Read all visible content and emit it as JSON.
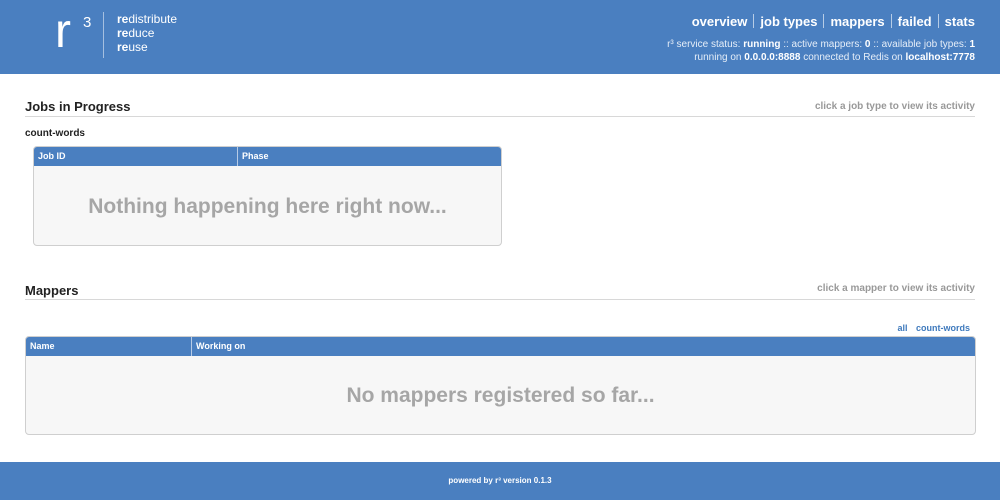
{
  "header": {
    "logo": {
      "r": "r",
      "superscript": "3",
      "lines": [
        {
          "bold": "re",
          "rest": "distribute"
        },
        {
          "bold": "re",
          "rest": "duce"
        },
        {
          "bold": "re",
          "rest": "use"
        }
      ]
    },
    "nav": [
      "overview",
      "job types",
      "mappers",
      "failed",
      "stats"
    ],
    "status": {
      "service_prefix": "r³ service status:",
      "service_value": "running",
      "mappers_prefix": ":: active mappers:",
      "mappers_value": "0",
      "jobtypes_prefix": ":: available job types:",
      "jobtypes_value": "1",
      "running_prefix": "running on",
      "running_value": "0.0.0.0:8888",
      "redis_prefix": "connected to Redis on",
      "redis_value": "localhost:7778"
    }
  },
  "jobs": {
    "title": "Jobs in Progress",
    "hint": "click a job type to view its activity",
    "job_type": "count-words",
    "columns": [
      "Job ID",
      "Phase"
    ],
    "empty_message": "Nothing happening here right now..."
  },
  "mappers": {
    "title": "Mappers",
    "hint": "click a mapper to view its activity",
    "filters": [
      "all",
      "count-words"
    ],
    "columns": [
      "Name",
      "Working on"
    ],
    "empty_message": "No mappers registered so far..."
  },
  "footer": {
    "text": "powered by r³ version 0.1.3"
  },
  "colors": {
    "brand_blue": "#4a7fc0",
    "empty_text": "#a6a6a6",
    "link": "#3f7abd"
  }
}
